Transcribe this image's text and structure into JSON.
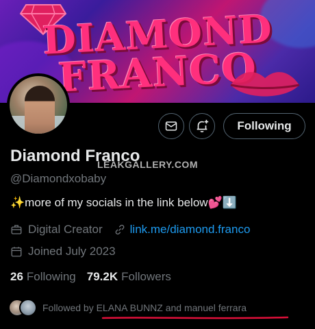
{
  "banner": {
    "line1": "DIAMOND",
    "line2": "FRANCO"
  },
  "actions": {
    "following_label": "Following"
  },
  "profile": {
    "name": "Diamond Franco",
    "handle": "@Diamondxobaby",
    "bio": "✨more of my socials in the link below💕⬇️",
    "category": "Digital Creator",
    "link": "link.me/diamond.franco",
    "joined": "Joined July 2023"
  },
  "watermark": "LEAKGALLERY.COM",
  "stats": {
    "following_count": "26",
    "following_label": "Following",
    "followers_count": "79.2K",
    "followers_label": "Followers"
  },
  "followed_by": {
    "text": "Followed by ELANA BUNNZ and manuel ferrara"
  },
  "colors": {
    "accent_link": "#1d9bf0",
    "muted": "#71767b",
    "underline": "#e0103a"
  }
}
